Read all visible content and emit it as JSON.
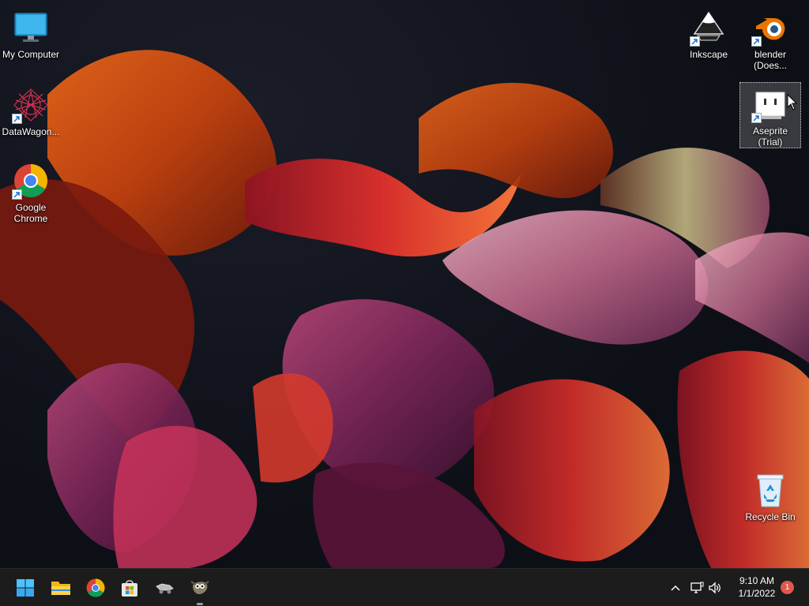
{
  "desktop": {
    "icons": [
      {
        "label": "My Computer",
        "icon": "monitor-icon",
        "shortcut": false
      },
      {
        "label": "DataWagon...",
        "icon": "datawagon-icon",
        "shortcut": true
      },
      {
        "label": "Google Chrome",
        "icon": "chrome-icon",
        "shortcut": true
      },
      {
        "label": "Inkscape",
        "icon": "inkscape-icon",
        "shortcut": true
      },
      {
        "label": "blender (Does...",
        "icon": "blender-icon",
        "shortcut": true
      },
      {
        "label": "Aseprite (Trial)",
        "icon": "aseprite-icon",
        "shortcut": true,
        "selected": true
      },
      {
        "label": "Recycle Bin",
        "icon": "recycle-bin-icon",
        "shortcut": false
      }
    ]
  },
  "taskbar": {
    "pinned": [
      {
        "name": "start",
        "icon": "windows-start-icon"
      },
      {
        "name": "file-explorer",
        "icon": "folder-icon"
      },
      {
        "name": "chrome",
        "icon": "chrome-icon"
      },
      {
        "name": "microsoft-store",
        "icon": "store-icon"
      },
      {
        "name": "datawagon",
        "icon": "datawagon-icon"
      },
      {
        "name": "gimp",
        "icon": "gimp-icon"
      }
    ],
    "tray": {
      "chevron_icon": "chevron-up-icon",
      "network_icon": "network-icon",
      "volume_icon": "speaker-icon",
      "time": "9:10 AM",
      "date": "1/1/2022",
      "notification_count": "1"
    }
  },
  "colors": {
    "taskbar_bg": "#1c1c1c",
    "badge": "#e0584c",
    "selection": "rgba(255,255,255,0.18)"
  }
}
